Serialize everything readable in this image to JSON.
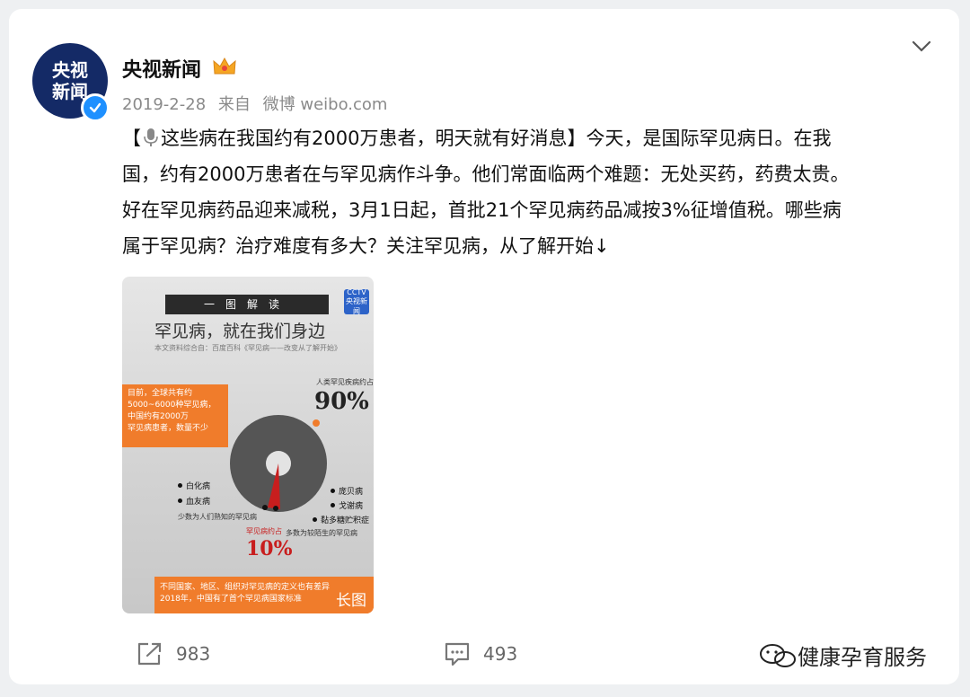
{
  "post": {
    "account_name": "央视新闻",
    "avatar_text": [
      "央视",
      "新闻"
    ],
    "date": "2019-2-28",
    "source_prefix": "来自",
    "source": "微博 weibo.com",
    "text_lines": [
      [
        "【",
        "这些病在我国约有2000万患者，明天就有好消息】今天，是国际罕见病日。在我"
      ],
      "国，约有2000万患者在与罕见病作斗争。他们常面临两个难题：无处买药，药费太贵。",
      "好在罕见病药品迎来减税，3月1日起，首批21个罕见病药品减按3%征增值税。哪些病",
      "属于罕见病？治疗难度有多大？关注罕见病，从了解开始↓"
    ]
  },
  "image": {
    "banner": "一图解读",
    "logo_text": "CCTV 央视新闻",
    "title": "罕见病，就在我们身边",
    "source_note": "本文资料综合自：百度百科《罕见病——改变从了解开始》",
    "intro_lines": [
      "目前，全球共有约",
      "5000~6000种罕见病，",
      "中国约有2000万",
      "罕见病患者，数量不少"
    ],
    "label_90": "人类罕见疾病约占",
    "pct_90": "90%",
    "left_diseases": [
      "白化病",
      "血友病"
    ],
    "left_caption": "少数为人们熟知的罕见病",
    "right_diseases": [
      "庞贝病",
      "戈谢病",
      "黏多糖贮积症"
    ],
    "right_caption": "多数为较陌生的罕见病",
    "label_10": "罕见病约占",
    "pct_10": "10%",
    "footer_lines": [
      "不同国家、地区、组织对罕见病的定义也有差异",
      "2018年，中国有了首个罕见病国家标准"
    ],
    "badge": "长图",
    "chart_share": {
      "known_pct": 10,
      "unfamiliar_pct": 90
    }
  },
  "actions": {
    "share_count": "983",
    "comment_count": "493"
  },
  "watermark": "健康孕育服务",
  "colors": {
    "orange": "#f07c2b",
    "navy": "#142a66",
    "verified": "#1e90ff",
    "crown": "#f5a623"
  }
}
